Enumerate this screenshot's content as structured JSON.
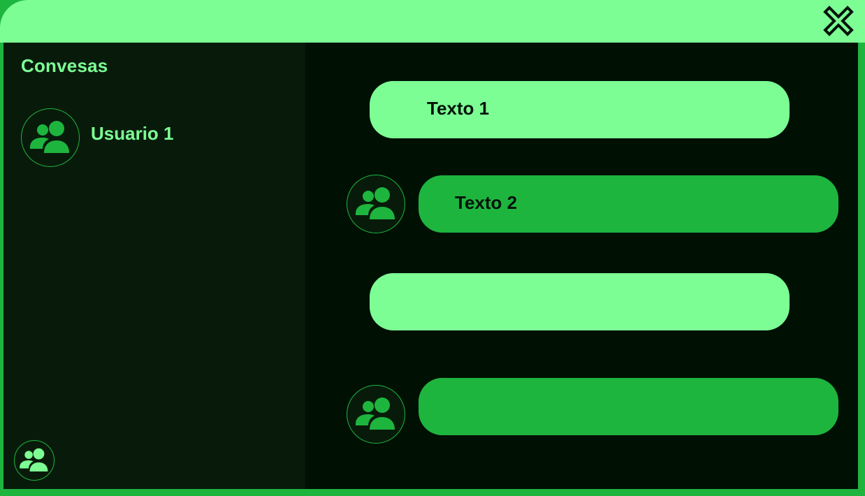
{
  "window": {
    "close_icon": "close-icon"
  },
  "sidebar": {
    "title": "Convesas",
    "conversations": [
      {
        "name": "Usuario 1",
        "icon": "users-icon"
      }
    ],
    "self_icon": "users-icon"
  },
  "chat": {
    "messages": [
      {
        "direction": "outgoing",
        "text": "Texto 1"
      },
      {
        "direction": "incoming",
        "text": "Texto 2",
        "icon": "users-icon"
      },
      {
        "direction": "outgoing",
        "text": ""
      },
      {
        "direction": "incoming",
        "text": "",
        "icon": "users-icon"
      }
    ]
  },
  "colors": {
    "accent_light": "#7dfe94",
    "accent": "#1eb53f",
    "sidebar_bg": "#081b0b",
    "chat_bg": "#001103"
  }
}
